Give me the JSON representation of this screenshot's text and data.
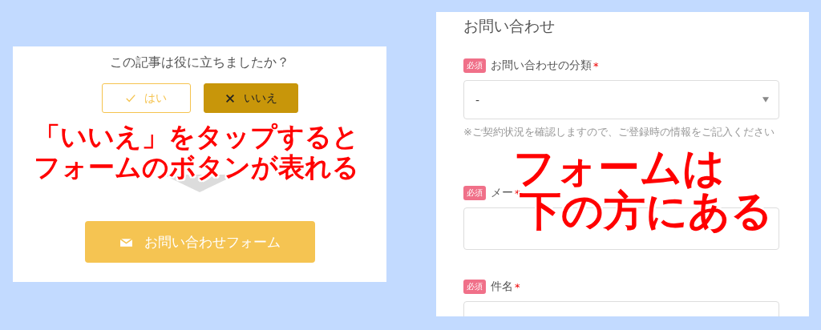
{
  "feedback_card": {
    "question": "この記事は役に立ちましたか？",
    "choices": [
      {
        "label": "はい",
        "selected": false
      },
      {
        "label": "いいえ",
        "selected": true
      }
    ],
    "form_button": {
      "label": "お問い合わせフォーム"
    }
  },
  "contact_form": {
    "title": "お問い合わせ",
    "fields": [
      {
        "kind": "select",
        "badge": "必須",
        "label": "お問い合わせの分類",
        "required_mark": "*",
        "value": "-",
        "note": "※ご契約状況を確認しますので、ご登録時の情報をご記入ください"
      },
      {
        "kind": "text",
        "badge": "必須",
        "label": "メー",
        "required_mark": "*"
      },
      {
        "kind": "text",
        "badge": "必須",
        "label": "件名",
        "required_mark": "*"
      }
    ]
  },
  "annotations": [
    {
      "lines": [
        "「いいえ」をタップすると",
        "フォームのボタンが表れる"
      ]
    },
    {
      "lines": [
        "フォームは",
        "下の方にある"
      ]
    }
  ]
}
